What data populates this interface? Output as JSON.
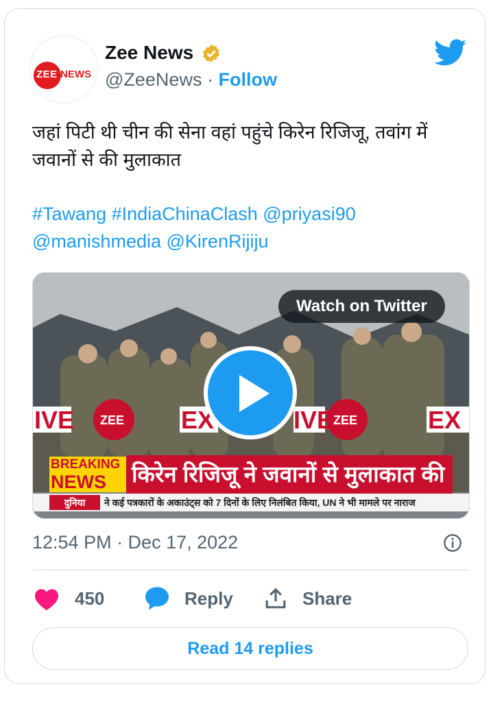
{
  "author": {
    "avatar_logo_text_1": "ZEE",
    "avatar_logo_text_2": "NEWS",
    "name": "Zee News",
    "handle": "@ZeeNews",
    "separator": "·",
    "follow_label": "Follow",
    "verified": true
  },
  "tweet": {
    "text": "जहां पिटी थी चीन की सेना वहां पहुंचे किरेन रिजिजू, तवांग में जवानों से की मुलाकात",
    "links": [
      "#Tawang",
      "#IndiaChinaClash",
      "@priyasi90",
      "@manishmedia",
      "@KirenRijiju"
    ]
  },
  "media": {
    "watch_label": "Watch on Twitter",
    "breaking_line1": "BREAKING",
    "breaking_line2": "NEWS",
    "headline": "किरेन रिजिजू ने जवानों से मुलाकात की",
    "ticker_tag": "दुनिया",
    "ticker_text": "ने कई पत्रकारों के अकाउंट्स को 7 दिनों के लिए निलंबित किया, UN ने भी मामले पर नाराज",
    "overlay_live": "IVE",
    "overlay_zee": "ZEE",
    "overlay_ex": "EX"
  },
  "meta": {
    "timestamp": "12:54 PM · Dec 17, 2022"
  },
  "actions": {
    "likes": "450",
    "reply_label": "Reply",
    "share_label": "Share"
  },
  "read_replies_label": "Read 14 replies",
  "colors": {
    "accent": "#1d9bf0",
    "heart": "#f91880",
    "verified": "#e8b52a",
    "brand_red": "#c8102e"
  },
  "icons": [
    "twitter-bird-icon",
    "verified-badge-icon",
    "play-icon",
    "info-icon",
    "heart-icon",
    "reply-bubble-icon",
    "share-icon"
  ]
}
